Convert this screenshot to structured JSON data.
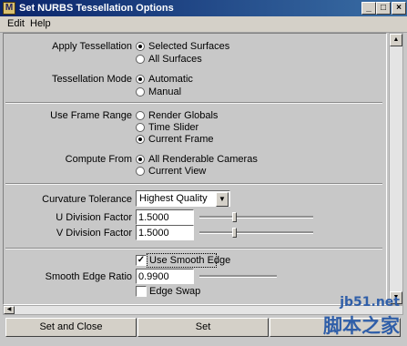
{
  "window": {
    "title": "Set NURBS Tessellation Options",
    "app_icon_letter": "M"
  },
  "title_buttons": {
    "minimize": "_",
    "maximize": "□",
    "close": "×"
  },
  "menu": [
    "Edit",
    "Help"
  ],
  "apply_tessellation": {
    "label": "Apply Tessellation",
    "options": [
      "Selected Surfaces",
      "All Surfaces"
    ],
    "selected": "Selected Surfaces"
  },
  "tessellation_mode": {
    "label": "Tessellation Mode",
    "options": [
      "Automatic",
      "Manual"
    ],
    "selected": "Automatic"
  },
  "use_frame_range": {
    "label": "Use Frame Range",
    "options": [
      "Render Globals",
      "Time Slider",
      "Current Frame"
    ],
    "selected": "Current Frame"
  },
  "compute_from": {
    "label": "Compute From",
    "options": [
      "All Renderable Cameras",
      "Current View"
    ],
    "selected": "All Renderable Cameras"
  },
  "curvature_tolerance": {
    "label": "Curvature Tolerance",
    "value": "Highest Quality"
  },
  "u_division_factor": {
    "label": "U Division Factor",
    "value": "1.5000",
    "slider_fraction": 0.3
  },
  "v_division_factor": {
    "label": "V Division Factor",
    "value": "1.5000",
    "slider_fraction": 0.3
  },
  "use_smooth_edge": {
    "label": "Use Smooth Edge",
    "checked": true
  },
  "smooth_edge_ratio": {
    "label": "Smooth Edge Ratio",
    "value": "0.9900"
  },
  "edge_swap": {
    "label": "Edge Swap",
    "checked": false
  },
  "buttons": {
    "set_and_close": "Set and Close",
    "set": "Set"
  },
  "watermark": {
    "url": "jb51.net",
    "text": "脚本之家"
  },
  "colors": {
    "titlebar_start": "#0a246a",
    "titlebar_end": "#3a6ea5",
    "panel_bg": "#c8c8c8",
    "watermark": "#2f5ea8"
  }
}
